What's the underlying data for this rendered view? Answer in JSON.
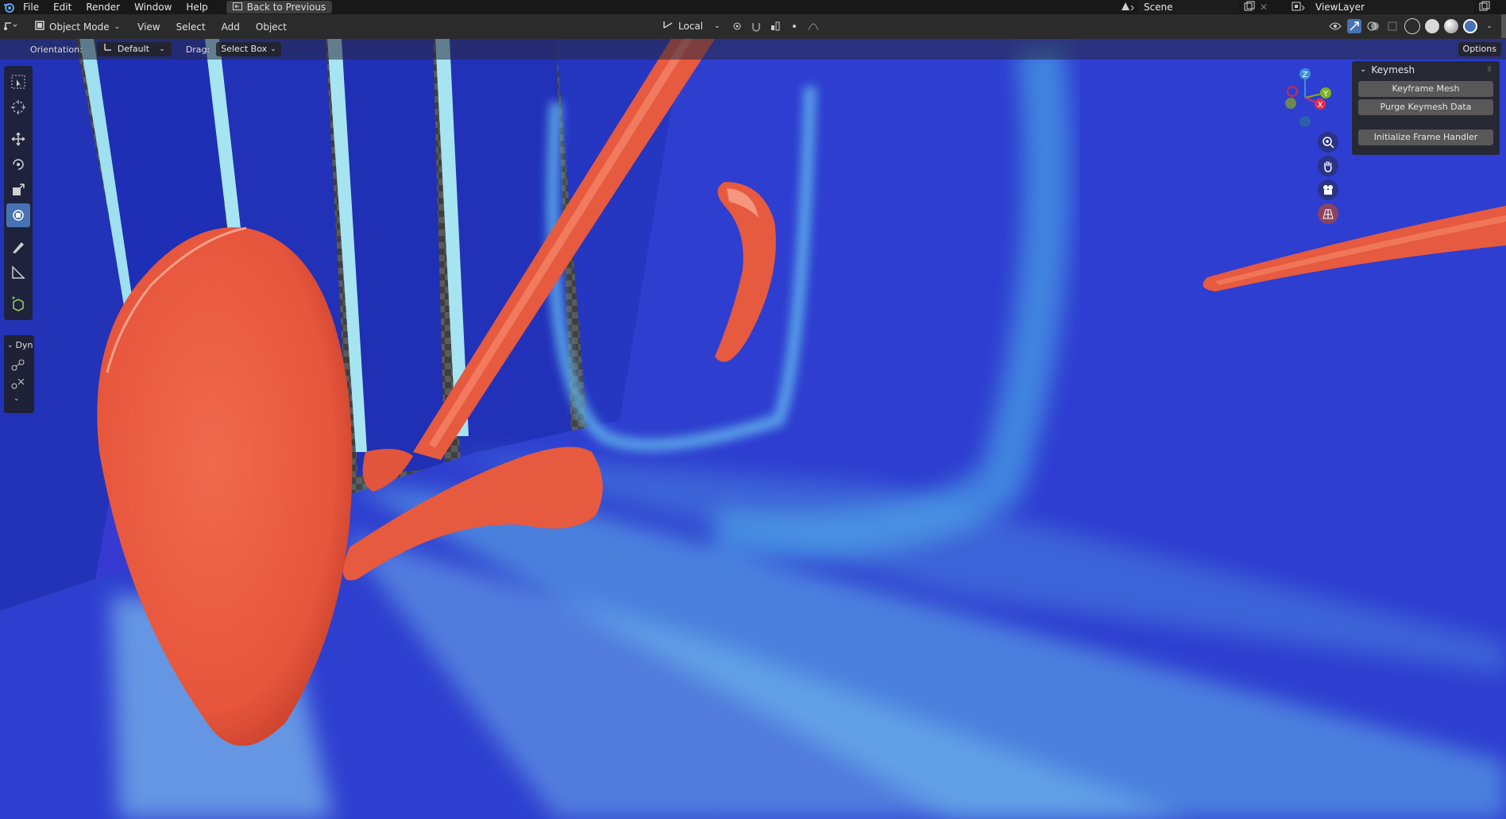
{
  "topbar": {
    "menu": [
      "File",
      "Edit",
      "Render",
      "Window",
      "Help"
    ],
    "back_label": "Back to Previous",
    "scene": "Scene",
    "view_layer": "ViewLayer"
  },
  "header": {
    "mode": "Object Mode",
    "menus": [
      "View",
      "Select",
      "Add",
      "Object"
    ],
    "transform_space": "Local"
  },
  "tool_header": {
    "orientation_label": "Orientation:",
    "orientation_value": "Default",
    "drag_label": "Drag:",
    "drag_value": "Select Box",
    "options_label": "Options"
  },
  "left_panel": {
    "dyn_label": "Dyn"
  },
  "gizmo": {
    "axes": [
      "Z",
      "Y",
      "X"
    ]
  },
  "npanel": {
    "title": "Keymesh",
    "buttons": [
      "Keyframe Mesh",
      "Purge Keymesh Data",
      "Initialize Frame Handler"
    ]
  },
  "colors": {
    "accent": "#4772b3",
    "viewport_bg": "#2f3fc8",
    "object": "#e8583f",
    "axis_x": "#e0304a",
    "axis_y": "#7fb020",
    "axis_z": "#3a8fd8"
  }
}
